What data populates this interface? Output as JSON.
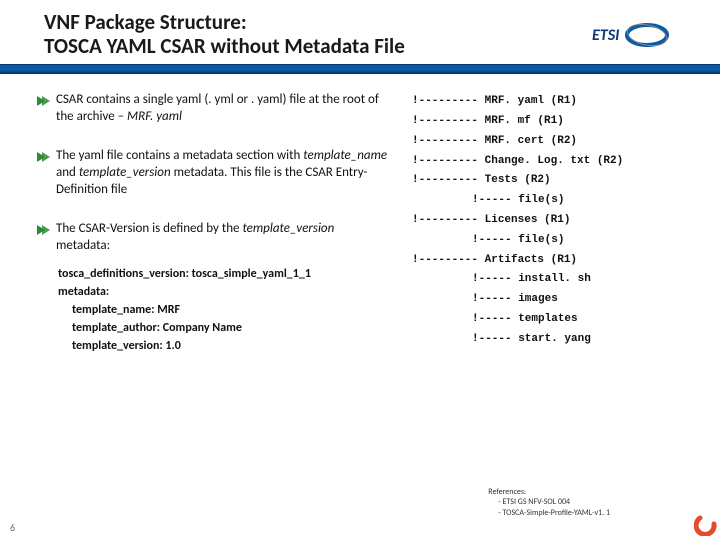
{
  "header": {
    "title_line1": "VNF Package Structure:",
    "title_line2": "TOSCA YAML CSAR without Metadata File",
    "logo_text": "ETSI"
  },
  "bullets": {
    "b1_prefix": "CSAR contains a single yaml (. yml or . yaml) file at the root of the archive – ",
    "b1_suffix": "MRF. yaml",
    "b2_prefix": "The yaml file contains a metadata section with ",
    "b2_mid": "template_name",
    "b2_and": " and ",
    "b2_mid2": "template_version",
    "b2_suffix": " metadata. This file is the CSAR Entry-Definition file",
    "b3_prefix": "The CSAR-Version is defined by the ",
    "b3_mid": "template_version",
    "b3_suffix": " metadata:"
  },
  "code": {
    "l1": "tosca_definitions_version: tosca_simple_yaml_1_1",
    "l2": "metadata:",
    "l3": "template_name: MRF",
    "l4": "template_author: Company Name",
    "l5": "template_version: 1.0"
  },
  "tree": {
    "t1": "!--------- MRF. yaml (R1)",
    "t2": "!--------- MRF. mf (R1)",
    "t3": "!--------- MRF. cert (R2)",
    "t4": "!--------- Change. Log. txt (R2)",
    "t5": "!--------- Tests (R2)",
    "t5a": "!----- file(s)",
    "t6": "!--------- Licenses (R1)",
    "t6a": "!----- file(s)",
    "t7": "!--------- Artifacts (R1)",
    "t7a": "!----- install. sh",
    "t7b": "!----- images",
    "t7c": "!----- templates",
    "t7d": "!----- start. yang"
  },
  "refs": {
    "title": "References:",
    "r1": "-   ETSI GS NFV-SOL 004",
    "r2": "-   TOSCA-Simple-Profile-YAML-v1. 1"
  },
  "page": "6"
}
